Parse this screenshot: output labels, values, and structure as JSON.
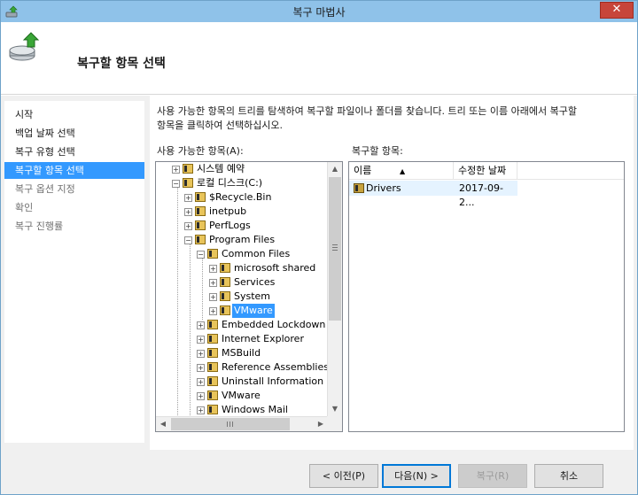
{
  "window": {
    "title": "복구 마법사",
    "close_label": "✕"
  },
  "header": {
    "title": "복구할 항목 선택"
  },
  "nav": {
    "items": [
      {
        "label": "시작"
      },
      {
        "label": "백업 날짜 선택"
      },
      {
        "label": "복구 유형 선택"
      },
      {
        "label": "복구할 항목 선택"
      },
      {
        "label": "복구 옵션 지정"
      },
      {
        "label": "확인"
      },
      {
        "label": "복구 진행률"
      }
    ]
  },
  "content": {
    "description_line1": "사용 가능한 항목의 트리를 탐색하여 복구할 파일이나 폴더를 찾습니다. 트리 또는 이름 아래에서 복구할",
    "description_line2": "항목을 클릭하여 선택하십시오.",
    "available_label": "사용 가능한 항목(A):",
    "restore_label": "복구할 항목:"
  },
  "tree": {
    "items": [
      {
        "label": "시스템 예약",
        "expander": "+"
      },
      {
        "label": "로컬 디스크(C:)",
        "expander": "−"
      },
      {
        "label": "$Recycle.Bin",
        "expander": "+"
      },
      {
        "label": "inetpub",
        "expander": "+"
      },
      {
        "label": "PerfLogs",
        "expander": "+"
      },
      {
        "label": "Program Files",
        "expander": "−"
      },
      {
        "label": "Common Files",
        "expander": "−"
      },
      {
        "label": "microsoft shared",
        "expander": "+"
      },
      {
        "label": "Services",
        "expander": "+"
      },
      {
        "label": "System",
        "expander": "+"
      },
      {
        "label": "VMware",
        "expander": "+"
      },
      {
        "label": "Embedded Lockdown M",
        "expander": "+"
      },
      {
        "label": "Internet Explorer",
        "expander": "+"
      },
      {
        "label": "MSBuild",
        "expander": "+"
      },
      {
        "label": "Reference Assemblies",
        "expander": "+"
      },
      {
        "label": "Uninstall Information",
        "expander": "+"
      },
      {
        "label": "VMware",
        "expander": "+"
      },
      {
        "label": "Windows Mail",
        "expander": "+"
      }
    ]
  },
  "list": {
    "columns": [
      "이름",
      "수정한 날짜"
    ],
    "sort_arrow": "▲",
    "rows": [
      {
        "name": "Drivers",
        "date": "2017-09-2..."
      }
    ]
  },
  "scroll": {
    "up": "▲",
    "down": "▼",
    "left": "◀",
    "right": "▶"
  },
  "buttons": {
    "prev": "< 이전(P)",
    "next": "다음(N) >",
    "restore": "복구(R)",
    "cancel": "취소"
  },
  "colors": {
    "titlebar": "#8fc2e9",
    "selection": "#3399ff",
    "close": "#c7453a"
  }
}
